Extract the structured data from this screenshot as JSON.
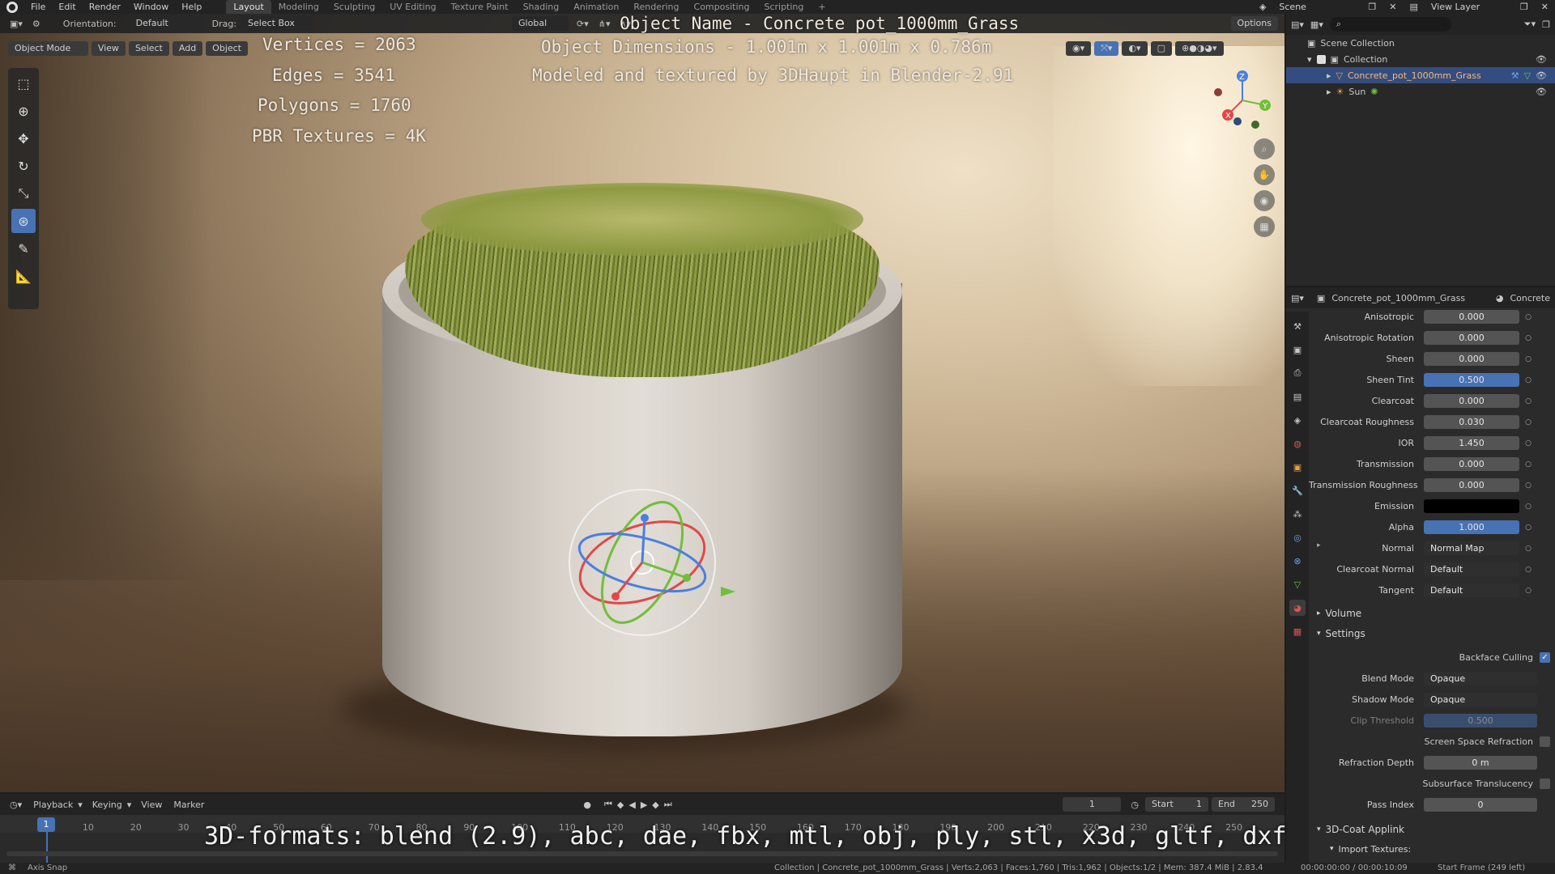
{
  "topbar": {
    "menus": [
      "File",
      "Edit",
      "Render",
      "Window",
      "Help"
    ],
    "workspaces": [
      "Layout",
      "Modeling",
      "Sculpting",
      "UV Editing",
      "Texture Paint",
      "Shading",
      "Animation",
      "Rendering",
      "Compositing",
      "Scripting",
      "+"
    ],
    "active_workspace": "Layout",
    "scene": "Scene",
    "view_layer": "View Layer"
  },
  "viewport_header": {
    "orientation_label": "Orientation:",
    "orientation_value": "Default",
    "drag_label": "Drag:",
    "drag_value": "Select Box",
    "transform": "Global",
    "options": "Options",
    "mode": "Object Mode",
    "menus": [
      "View",
      "Select",
      "Add",
      "Object"
    ]
  },
  "overlay": {
    "object_name": "Object Name - Concrete pot_1000mm_Grass",
    "dimensions": "Object Dimensions -  1.001m x 1.001m x 0.786m",
    "credit": "Modeled and textured by 3DHaupt in Blender-2.91",
    "vertices": "Vertices = 2063",
    "edges": "Edges = 3541",
    "polygons": "Polygons = 1760",
    "textures": "PBR Textures = 4K",
    "formats": "3D-formats: blend (2.9), abc, dae, fbx, mtl, obj, ply, stl, x3d, gltf, dxf"
  },
  "outliner": {
    "root": "Scene Collection",
    "collection": "Collection",
    "items": [
      "Concrete_pot_1000mm_Grass",
      "Sun"
    ]
  },
  "properties": {
    "object": "Concrete_pot_1000mm_Grass",
    "material": "Concrete",
    "rows": [
      {
        "label": "Anisotropic",
        "value": "0.000",
        "style": "num"
      },
      {
        "label": "Anisotropic Rotation",
        "value": "0.000",
        "style": "num"
      },
      {
        "label": "Sheen",
        "value": "0.000",
        "style": "num"
      },
      {
        "label": "Sheen Tint",
        "value": "0.500",
        "style": "blue"
      },
      {
        "label": "Clearcoat",
        "value": "0.000",
        "style": "num"
      },
      {
        "label": "Clearcoat Roughness",
        "value": "0.030",
        "style": "num"
      },
      {
        "label": "IOR",
        "value": "1.450",
        "style": "num"
      },
      {
        "label": "Transmission",
        "value": "0.000",
        "style": "num"
      },
      {
        "label": "Transmission Roughness",
        "value": "0.000",
        "style": "num"
      },
      {
        "label": "Emission",
        "value": "",
        "style": "black"
      },
      {
        "label": "Alpha",
        "value": "1.000",
        "style": "blue"
      },
      {
        "label": "Normal",
        "value": "Normal Map",
        "style": "dd"
      },
      {
        "label": "Clearcoat Normal",
        "value": "Default",
        "style": "dd"
      },
      {
        "label": "Tangent",
        "value": "Default",
        "style": "dd"
      }
    ],
    "volume": "Volume",
    "settings": "Settings",
    "backface_culling": "Backface Culling",
    "blend_mode_label": "Blend Mode",
    "blend_mode": "Opaque",
    "shadow_mode_label": "Shadow Mode",
    "shadow_mode": "Opaque",
    "clip_threshold_label": "Clip Threshold",
    "clip_threshold": "0.500",
    "ssr_label": "Screen Space Refraction",
    "refraction_depth_label": "Refraction Depth",
    "refraction_depth": "0 m",
    "sss_label": "Subsurface Translucency",
    "pass_index_label": "Pass Index",
    "pass_index": "0",
    "applink": "3D-Coat Applink",
    "import_textures": "Import Textures:"
  },
  "timeline": {
    "menus": [
      "Playback",
      "Keying",
      "View",
      "Marker"
    ],
    "current_frame": "1",
    "start_label": "Start",
    "start": "1",
    "end_label": "End",
    "end": "250",
    "ticks": [
      "1",
      "10",
      "20",
      "30",
      "40",
      "50",
      "60",
      "70",
      "80",
      "90",
      "100",
      "110",
      "120",
      "130",
      "140",
      "150",
      "160",
      "170",
      "180",
      "190",
      "200",
      "210",
      "220",
      "230",
      "240",
      "250"
    ]
  },
  "statusbar": {
    "left": "Axis Snap",
    "info": "Collection | Concrete_pot_1000mm_Grass | Verts:2,063 | Faces:1,760 | Tris:1,962 | Objects:1/2 | Mem: 387.4 MiB | 2.83.4",
    "time": "00:00:00:00 / 00:00:10:09",
    "frames": "Start Frame (249 left)"
  },
  "colors": {
    "accent": "#4772b3",
    "header": "#232323",
    "panel": "#2b2b2b"
  }
}
